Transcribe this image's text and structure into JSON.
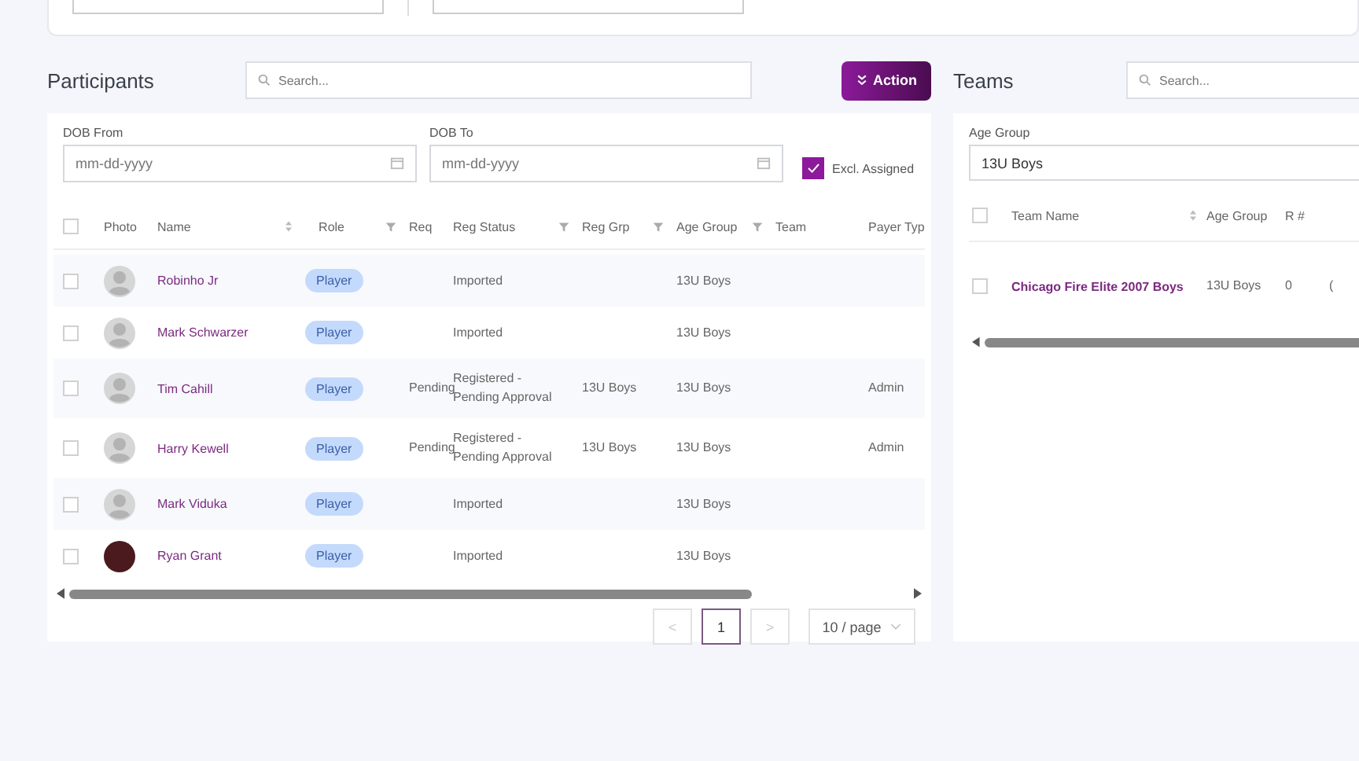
{
  "participants": {
    "title": "Participants",
    "search": {
      "placeholder": "Search..."
    },
    "action_button": "Action",
    "filters": {
      "dob_from": {
        "label": "DOB From",
        "placeholder": "mm-dd-yyyy"
      },
      "dob_to": {
        "label": "DOB To",
        "placeholder": "mm-dd-yyyy"
      },
      "excl_assigned": {
        "label": "Excl. Assigned",
        "checked": true
      }
    },
    "select_all_checked": false,
    "columns": [
      {
        "label": "Photo",
        "sortable": false,
        "filter": false
      },
      {
        "label": "Name",
        "sortable": true,
        "filter": false
      },
      {
        "label": "Role",
        "sortable": false,
        "filter": true
      },
      {
        "label": "Req",
        "sortable": false,
        "filter": false
      },
      {
        "label": "Reg Status",
        "sortable": false,
        "filter": true
      },
      {
        "label": "Reg Grp",
        "sortable": false,
        "filter": true
      },
      {
        "label": "Age Group",
        "sortable": false,
        "filter": true
      },
      {
        "label": "Team",
        "sortable": false,
        "filter": false
      },
      {
        "label": "Payer Typ"
      }
    ],
    "rows": [
      {
        "kind": "avatar",
        "name": "Robinho Jr",
        "role": "Player",
        "reg_status": "Imported",
        "age_group": "13U Boys",
        "checked": false
      },
      {
        "kind": "avatar",
        "name": "Mark Schwarzer",
        "role": "Player",
        "reg_status": "Imported",
        "age_group": "13U Boys",
        "checked": false
      },
      {
        "kind": "avatar",
        "name": "Tim Cahill",
        "role": "Player",
        "req": "Pending",
        "reg_status": "Registered - Pending Approval",
        "reg_grp": "13U Boys",
        "age_group": "13U Boys",
        "payer": "Admin",
        "checked": false
      },
      {
        "kind": "avatar",
        "name": "Harry Kewell",
        "role": "Player",
        "req": "Pending",
        "reg_status": "Registered - Pending Approval",
        "reg_grp": "13U Boys",
        "age_group": "13U Boys",
        "payer": "Admin",
        "checked": false
      },
      {
        "kind": "avatar",
        "name": "Mark Viduka",
        "role": "Player",
        "reg_status": "Imported",
        "age_group": "13U Boys",
        "checked": false
      },
      {
        "kind": "photo",
        "name": "Ryan Grant",
        "role": "Player",
        "reg_status": "Imported",
        "age_group": "13U Boys",
        "checked": false
      }
    ],
    "pagination": {
      "prev": "<",
      "pages": [
        {
          "label": "1",
          "selected": true
        }
      ],
      "next": ">",
      "page_size": "10 / page"
    }
  },
  "teams": {
    "title": "Teams",
    "search": {
      "placeholder": "Search..."
    },
    "age_group": {
      "label": "Age Group",
      "value": "13U Boys"
    },
    "select_all_checked": false,
    "columns": [
      {
        "label": "Team Name",
        "sortable": true
      },
      {
        "label": "Age Group",
        "sortable": false
      },
      {
        "label": "R #",
        "sortable": false
      }
    ],
    "rows": [
      {
        "name": "Chicago Fire Elite 2007 Boys",
        "age_group": "13U Boys",
        "r": "0",
        "column_4": "(",
        "checked": false
      }
    ]
  }
}
